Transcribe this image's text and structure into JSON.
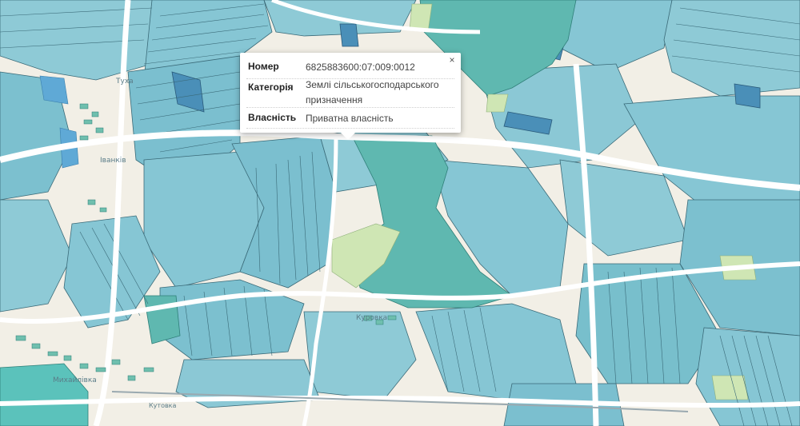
{
  "popup": {
    "close_label": "×",
    "rows": [
      {
        "key": "Номер",
        "value": "6825883600:07:009:0012"
      },
      {
        "key": "Категорія",
        "value": "Землі сільськогосподарського призначення"
      },
      {
        "key": "Власність",
        "value": "Приватна власність"
      }
    ]
  },
  "map_labels": {
    "label_1": "Туха",
    "label_2": "Іванків",
    "label_3": "Михайлівка",
    "label_4": "Куровка",
    "label_5": "Кутовка"
  },
  "colors": {
    "background": "#f2efe6",
    "parcel_light": "#8ecad6",
    "parcel_mid": "#78bfcc",
    "parcel_teal": "#5fb8b0",
    "parcel_dark": "#4a8fb8",
    "forest_green": "#cfe6b4",
    "water": "#5bc2bb",
    "road": "#ffffff",
    "outline": "#3a6a78"
  }
}
